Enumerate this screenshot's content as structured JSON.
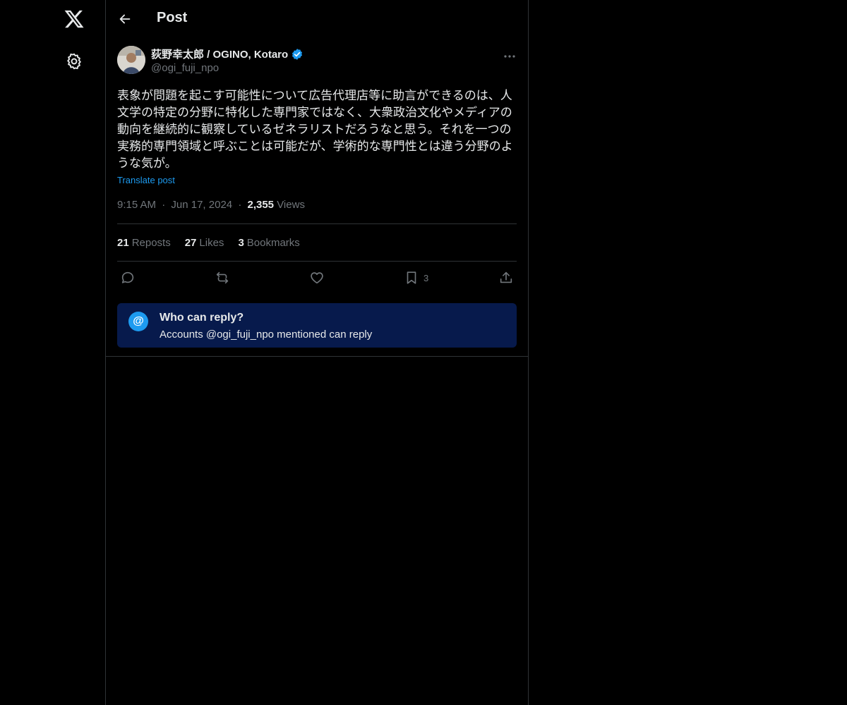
{
  "header": {
    "title": "Post"
  },
  "author": {
    "name": "荻野幸太郎 / OGINO, Kotaro",
    "handle": "@ogi_fuji_npo",
    "verified": true
  },
  "post": {
    "text": "表象が問題を起こす可能性について広告代理店等に助言ができるのは、人文学の特定の分野に特化した専門家ではなく、大衆政治文化やメディアの動向を継続的に観察しているゼネラリストだろうなと思う。それを一つの実務的専門領域と呼ぶことは可能だが、学術的な専門性とは違う分野のような気が。",
    "translate_label": "Translate post",
    "time": "9:15 AM",
    "date": "Jun 17, 2024",
    "views_count": "2,355",
    "views_label": "Views",
    "separator": "·"
  },
  "stats": {
    "reposts_count": "21",
    "reposts_label": "Reposts",
    "likes_count": "27",
    "likes_label": "Likes",
    "bookmarks_count": "3",
    "bookmarks_label": "Bookmarks"
  },
  "actions": {
    "bookmark_count": "3"
  },
  "reply_settings": {
    "title": "Who can reply?",
    "subtitle": "Accounts @ogi_fuji_npo mentioned can reply",
    "icon_glyph": "@"
  },
  "icons": {
    "logo": "x-logo-icon",
    "settings": "gear-icon",
    "back": "arrow-left-icon",
    "more": "more-dots-icon",
    "reply": "reply-icon",
    "repost": "repost-icon",
    "like": "heart-icon",
    "bookmark": "bookmark-icon",
    "share": "share-icon"
  },
  "colors": {
    "background": "#000000",
    "accent": "#1d9bf0",
    "muted": "#71767b",
    "text": "#e7e9ea",
    "reply_box": "#071a4c"
  }
}
